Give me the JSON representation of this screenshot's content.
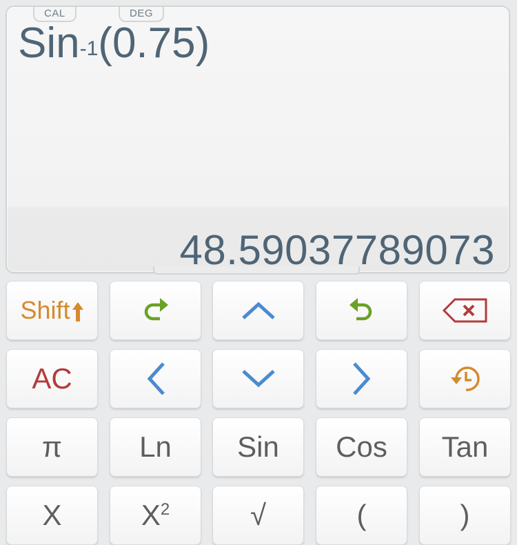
{
  "display": {
    "mode_tabs": [
      "CAL",
      "DEG"
    ],
    "expression": {
      "func": "Sin",
      "sup": "-1",
      "args": "(0.75)"
    },
    "result": "48.59037789073"
  },
  "colors": {
    "text": "#4f6576",
    "shift": "#d68a2e",
    "redo_undo": "#6aa126",
    "arrow": "#4a8bd0",
    "clear": "#b33b3b",
    "history": "#d68a2e",
    "key_label": "#5e5e5e"
  },
  "keys": {
    "row1": [
      {
        "label": "Shift",
        "icon": "arrow-up-icon"
      },
      {
        "icon": "redo-icon"
      },
      {
        "icon": "chevron-up-icon"
      },
      {
        "icon": "undo-icon"
      },
      {
        "icon": "backspace-icon"
      }
    ],
    "row2": [
      {
        "label": "AC"
      },
      {
        "icon": "chevron-left-icon"
      },
      {
        "icon": "chevron-down-icon"
      },
      {
        "icon": "chevron-right-icon"
      },
      {
        "icon": "history-icon"
      }
    ],
    "row3": [
      {
        "label": "π"
      },
      {
        "label": "Ln"
      },
      {
        "label": "Sin"
      },
      {
        "label": "Cos"
      },
      {
        "label": "Tan"
      }
    ],
    "row4": [
      {
        "label": "X"
      },
      {
        "label": "X",
        "sup": "2"
      },
      {
        "label": "√"
      },
      {
        "label": "("
      },
      {
        "label": ")"
      }
    ]
  }
}
